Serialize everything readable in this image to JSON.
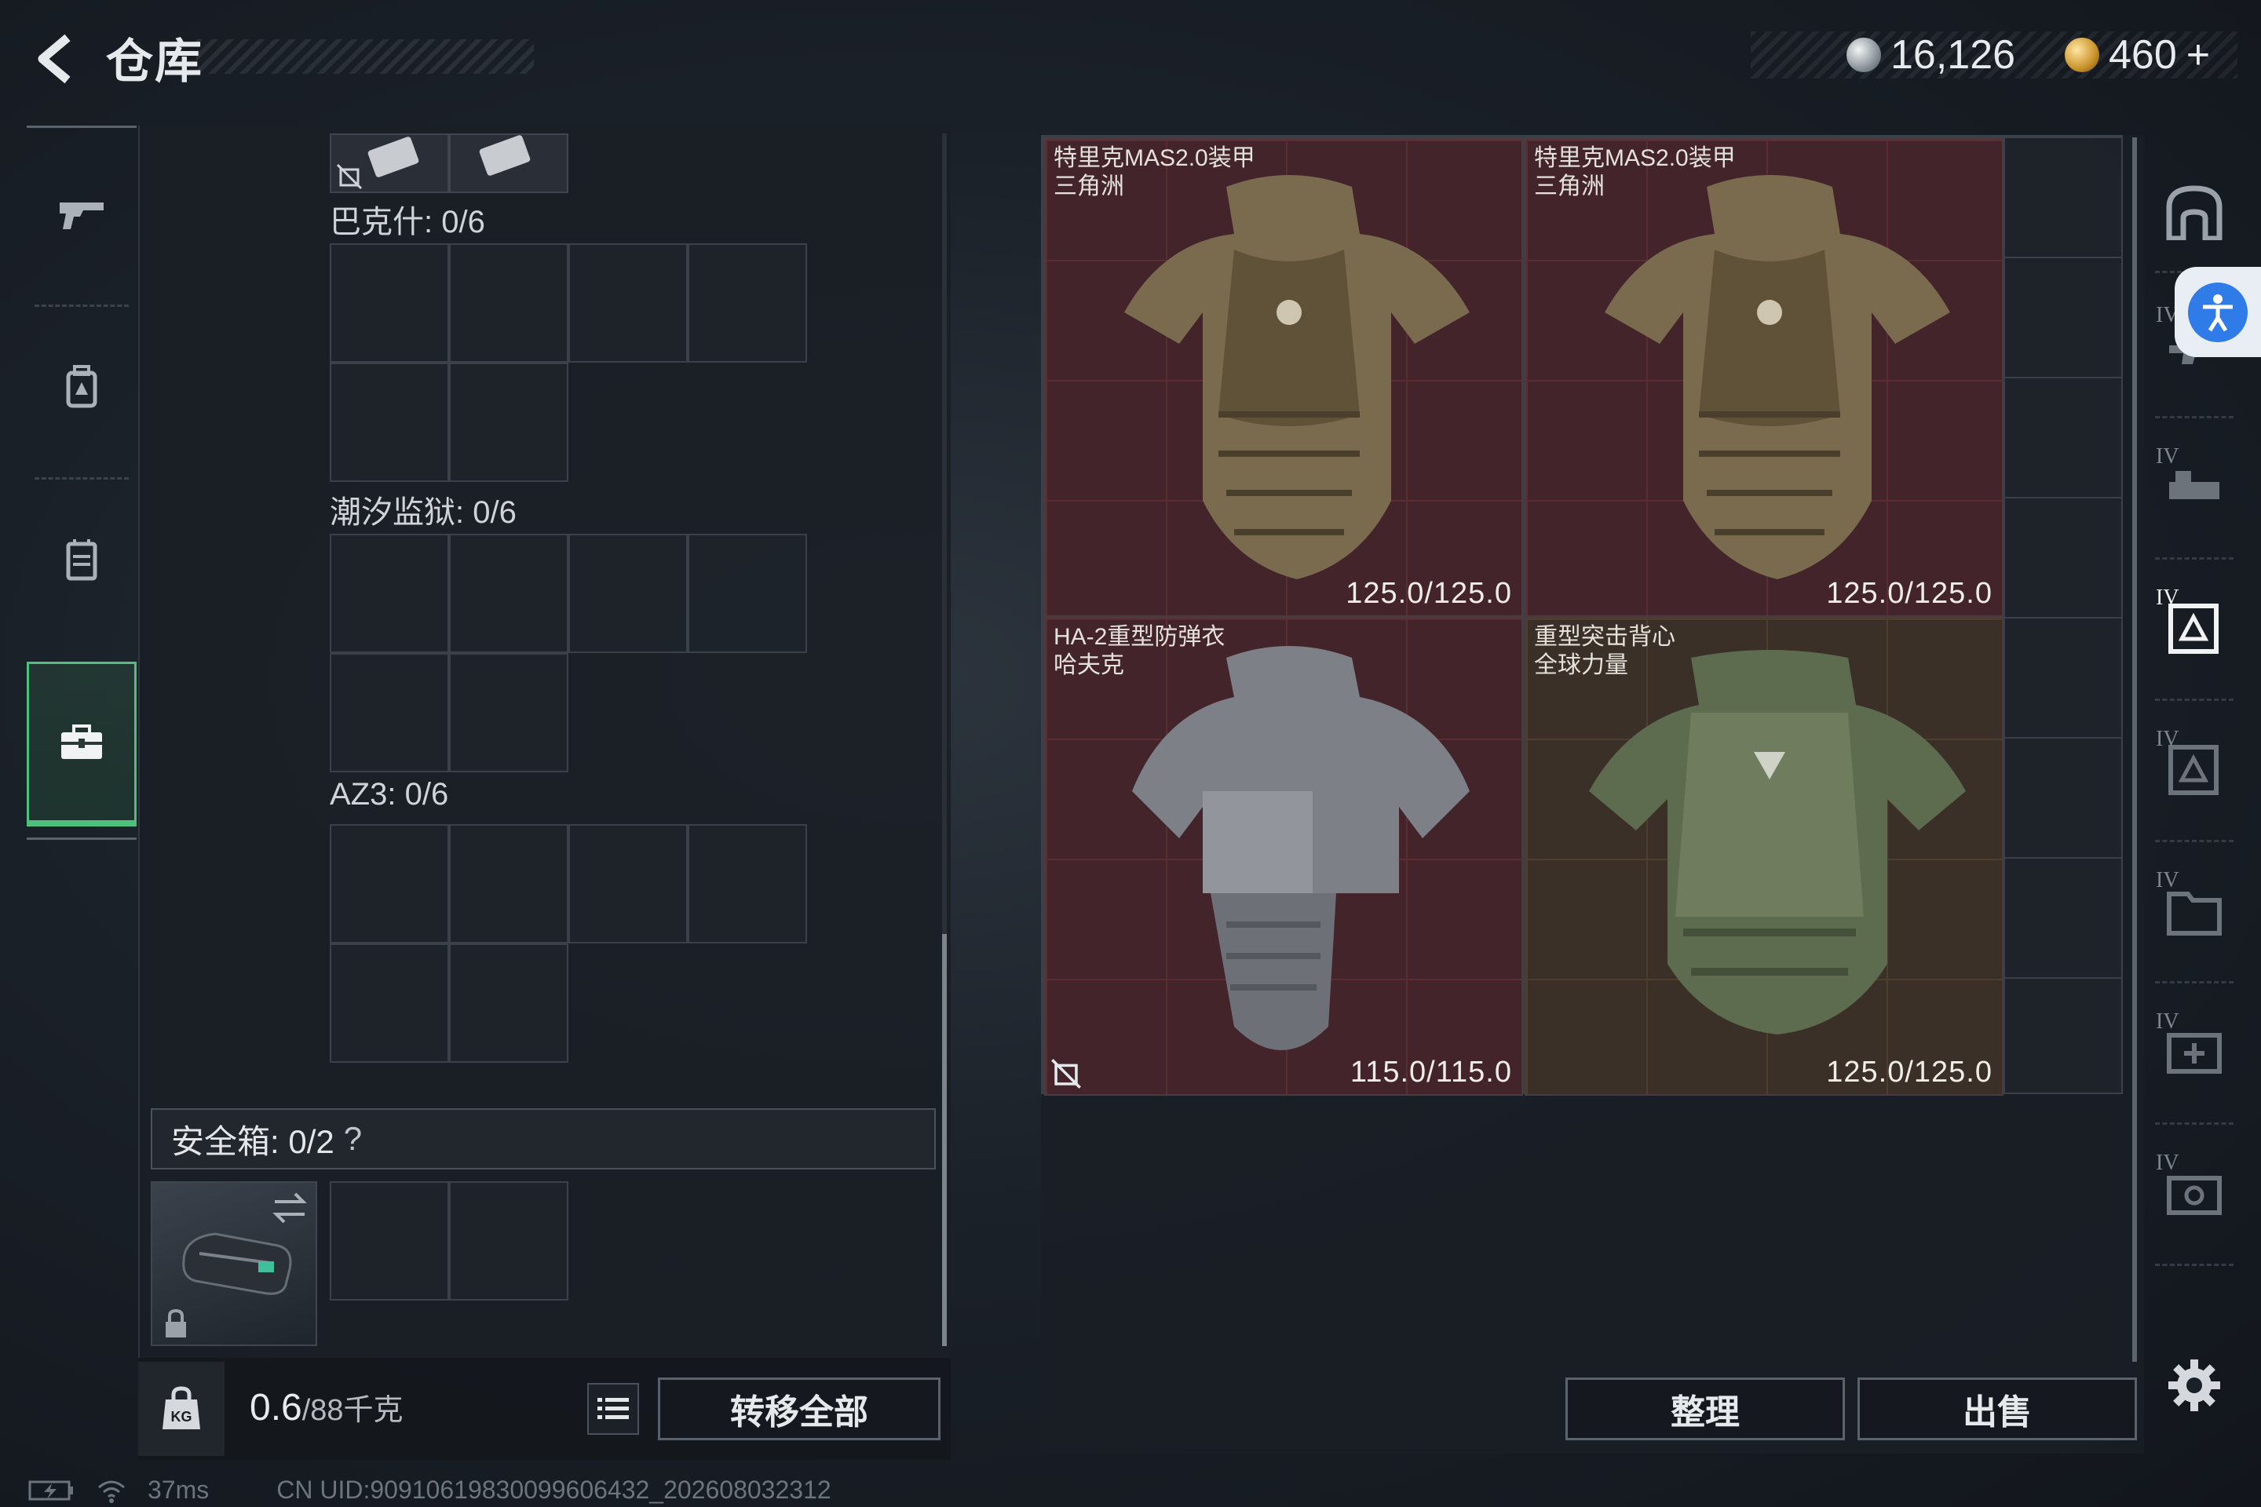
{
  "header": {
    "title": "仓库"
  },
  "currency": {
    "silver": "16,126",
    "gold": "460",
    "gold_plus": "+"
  },
  "nav": [
    "weapon-icon",
    "backpack-icon",
    "vest-icon",
    "case-icon"
  ],
  "left": {
    "sections": [
      {
        "label": "巴克什: 0/6"
      },
      {
        "label": "潮汐监狱: 0/6"
      },
      {
        "label": "AZ3: 0/6"
      }
    ],
    "safe_box": {
      "label": "安全箱: 0/2",
      "help": "?"
    },
    "weight": {
      "value": "0.6",
      "unit": "/88千克"
    },
    "transfer_all": "转移全部"
  },
  "items": [
    {
      "name": "特里克MAS2.0装甲\n三角洲",
      "durability": "125.0/125.0"
    },
    {
      "name": "特里克MAS2.0装甲\n三角洲",
      "durability": "125.0/125.0"
    },
    {
      "name": "HA-2重型防弹衣\n哈夫克",
      "durability": "115.0/115.0"
    },
    {
      "name": "重型突击背心\n全球力量",
      "durability": "125.0/125.0"
    }
  ],
  "buttons": {
    "organize": "整理",
    "sell": "出售"
  },
  "rail": {
    "tier_label": "IV"
  },
  "status": {
    "ping": "37ms",
    "uid": "CN UID:9091061983009960​6432_202608032312"
  }
}
